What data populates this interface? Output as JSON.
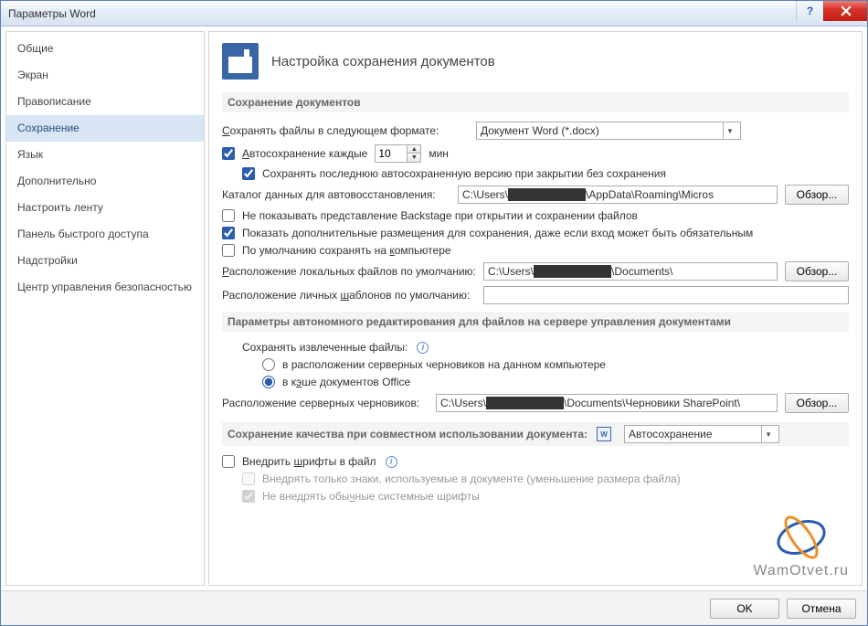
{
  "title": "Параметры Word",
  "sidebar": {
    "items": [
      {
        "label": "Общие"
      },
      {
        "label": "Экран"
      },
      {
        "label": "Правописание"
      },
      {
        "label": "Сохранение"
      },
      {
        "label": "Язык"
      },
      {
        "label": "Дополнительно"
      },
      {
        "label": "Настроить ленту"
      },
      {
        "label": "Панель быстрого доступа"
      },
      {
        "label": "Надстройки"
      },
      {
        "label": "Центр управления безопасностью"
      }
    ],
    "selected_index": 3
  },
  "main": {
    "heading": "Настройка сохранения документов",
    "group1": "Сохранение документов",
    "save_format_label": "Сохранять файлы в следующем формате:",
    "save_format_value": "Документ Word (*.docx)",
    "autosave_label": "Автосохранение каждые",
    "autosave_value": "10",
    "autosave_unit": "мин",
    "keep_last_label": "Сохранять последнюю автосохраненную версию при закрытии без сохранения",
    "autorecover_path_label": "Каталог данных для автовосстановления:",
    "autorecover_path_value_pre": "C:\\Users\\",
    "autorecover_path_value_post": "\\AppData\\Roaming\\Micros",
    "browse": "Обзор...",
    "dont_show_backstage": "Не показывать представление Backstage при открытии и сохранении файлов",
    "show_additional": "Показать дополнительные размещения для сохранения, даже если вход может быть обязательным",
    "save_local_default": "По умолчанию сохранять на компьютере",
    "local_files_label": "Расположение локальных файлов по умолчанию:",
    "local_files_value_pre": "C:\\Users\\",
    "local_files_value_post": "\\Documents\\",
    "templates_label": "Расположение личных шаблонов по умолчанию:",
    "templates_value": "",
    "group2": "Параметры автономного редактирования для файлов на сервере управления документами",
    "save_extracted_label": "Сохранять извлеченные файлы:",
    "radio_server": "в расположении серверных черновиков на данном компьютере",
    "radio_cache": "в кэше документов Office",
    "server_drafts_label": "Расположение серверных черновиков:",
    "server_drafts_value_pre": "C:\\Users\\",
    "server_drafts_value_post": "\\Documents\\Черновики SharePoint\\",
    "group3_label": "Сохранение качества при совместном использовании документа:",
    "group3_value": "Автосохранение",
    "embed_fonts": "Внедрить шрифты в файл",
    "embed_only_used": "Внедрять только знаки, используемые в документе (уменьшение размера файла)",
    "dont_embed_system": "Не внедрять обычные системные шрифты"
  },
  "footer": {
    "ok": "OK",
    "cancel": "Отмена"
  },
  "watermark": "WamOtvet.ru"
}
